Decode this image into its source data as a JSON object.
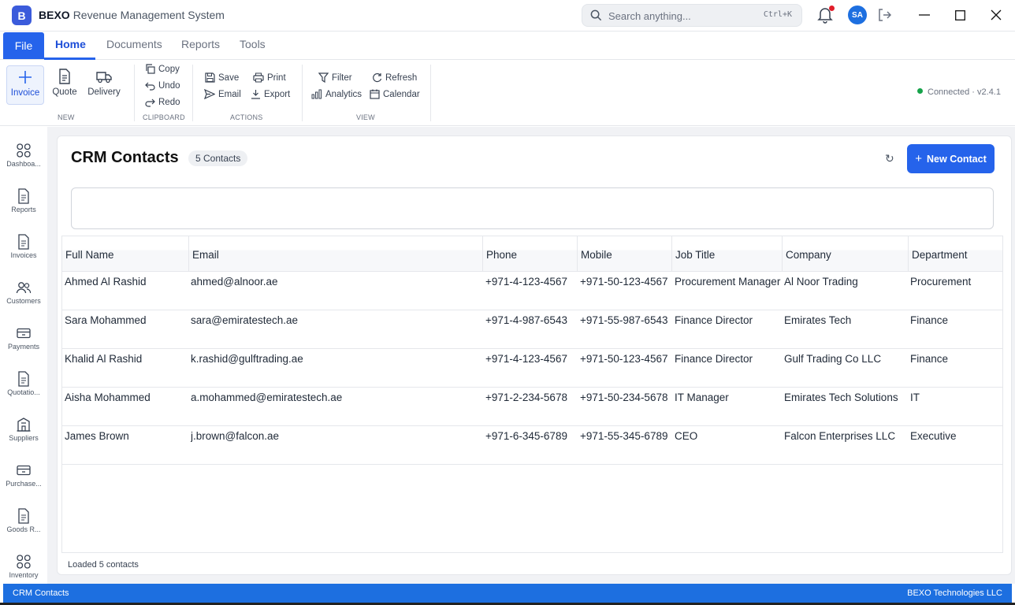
{
  "app": {
    "logo_letter": "B",
    "brand": "BEXO",
    "title": "Revenue Management System"
  },
  "search": {
    "placeholder": "Search anything...",
    "shortcut": "Ctrl+K"
  },
  "user": {
    "initials": "SA"
  },
  "menu": {
    "file": "File",
    "tabs": [
      "Home",
      "Documents",
      "Reports",
      "Tools"
    ],
    "active": "Home"
  },
  "ribbon": {
    "new": {
      "group": "NEW",
      "invoice": "Invoice",
      "quote": "Quote",
      "delivery": "Delivery"
    },
    "clipboard": {
      "group": "CLIPBOARD",
      "copy": "Copy",
      "undo": "Undo",
      "redo": "Redo"
    },
    "actions": {
      "group": "ACTIONS",
      "save": "Save",
      "print": "Print",
      "email": "Email",
      "export": "Export"
    },
    "view": {
      "group": "VIEW",
      "filter": "Filter",
      "refresh": "Refresh",
      "analytics": "Analytics",
      "calendar": "Calendar"
    },
    "status": {
      "text": "Connected",
      "separator": "·",
      "version": "v2.4.1",
      "color": "#16a34a"
    }
  },
  "sidebar": {
    "items": [
      {
        "label": "Dashboa...",
        "icon": "grid-icon"
      },
      {
        "label": "Reports",
        "icon": "document-icon"
      },
      {
        "label": "Invoices",
        "icon": "document-icon"
      },
      {
        "label": "Customers",
        "icon": "users-icon"
      },
      {
        "label": "Payments",
        "icon": "card-icon"
      },
      {
        "label": "Quotatio...",
        "icon": "document-icon"
      },
      {
        "label": "Suppliers",
        "icon": "building-icon"
      },
      {
        "label": "Purchase...",
        "icon": "card-icon"
      },
      {
        "label": "Goods R...",
        "icon": "document-icon"
      },
      {
        "label": "Inventory",
        "icon": "grid-icon"
      }
    ]
  },
  "page": {
    "title": "CRM Contacts",
    "count_badge": "5  Contacts",
    "refresh_glyph": "↻",
    "new_button": "New Contact",
    "new_button_plus": "+"
  },
  "table": {
    "columns": [
      "Full Name",
      "Email",
      "Phone",
      "Mobile",
      "Job Title",
      "Company",
      "Department"
    ],
    "rows": [
      [
        "Ahmed Al Rashid",
        "ahmed@alnoor.ae",
        "+971-4-123-4567",
        "+971-50-123-4567",
        "Procurement Manager",
        "Al Noor Trading",
        "Procurement"
      ],
      [
        "Sara Mohammed",
        "sara@emiratestech.ae",
        "+971-4-987-6543",
        "+971-55-987-6543",
        "Finance Director",
        "Emirates Tech",
        "Finance"
      ],
      [
        "Khalid Al Rashid",
        "k.rashid@gulftrading.ae",
        "+971-4-123-4567",
        "+971-50-123-4567",
        "Finance Director",
        "Gulf Trading Co LLC",
        "Finance"
      ],
      [
        "Aisha Mohammed",
        "a.mohammed@emiratestech.ae",
        "+971-2-234-5678",
        "+971-50-234-5678",
        "IT Manager",
        "Emirates Tech Solutions",
        "IT"
      ],
      [
        "James Brown",
        "j.brown@falcon.ae",
        "+971-6-345-6789",
        "+971-55-345-6789",
        "CEO",
        "Falcon Enterprises LLC",
        "Executive"
      ]
    ]
  },
  "footer": {
    "loaded": "Loaded 5 contacts"
  },
  "statusbar": {
    "left": "CRM Contacts",
    "right": "BEXO Technologies LLC"
  },
  "colors": {
    "accent": "#2563eb",
    "statusbar": "#1d6fe0"
  }
}
